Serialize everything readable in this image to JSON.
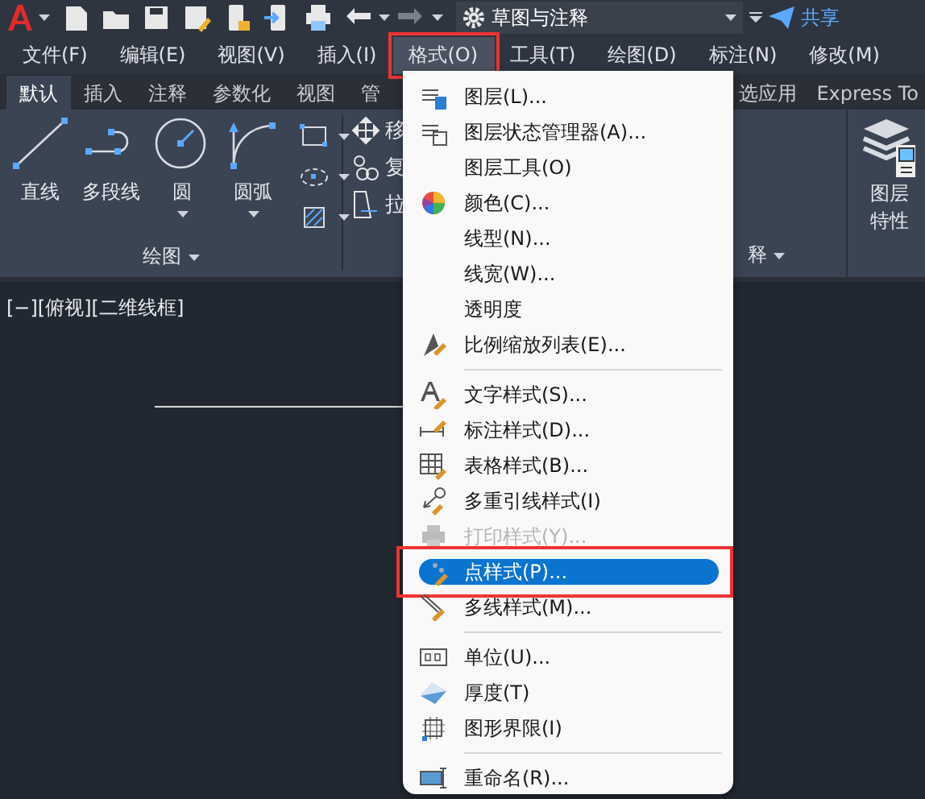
{
  "quick_access": {
    "workspace": "草图与注释",
    "share": "共享"
  },
  "menubar": [
    {
      "label": "文件(F)",
      "selected": false,
      "highlighted": false
    },
    {
      "label": "编辑(E)",
      "selected": false,
      "highlighted": false
    },
    {
      "label": "视图(V)",
      "selected": false,
      "highlighted": false
    },
    {
      "label": "插入(I)",
      "selected": false,
      "highlighted": false
    },
    {
      "label": "格式(O)",
      "selected": true,
      "highlighted": true
    },
    {
      "label": "工具(T)",
      "selected": false,
      "highlighted": false
    },
    {
      "label": "绘图(D)",
      "selected": false,
      "highlighted": false
    },
    {
      "label": "标注(N)",
      "selected": false,
      "highlighted": false
    },
    {
      "label": "修改(M)",
      "selected": false,
      "highlighted": false
    }
  ],
  "ribbon": {
    "tabs": [
      {
        "label": "默认",
        "selected": true
      },
      {
        "label": "插入",
        "selected": false
      },
      {
        "label": "注释",
        "selected": false
      },
      {
        "label": "参数化",
        "selected": false
      },
      {
        "label": "视图",
        "selected": false
      },
      {
        "label": "管",
        "selected": false
      }
    ],
    "tabs_right": [
      {
        "label": "选应用",
        "selected": false
      },
      {
        "label": "Express To",
        "selected": false
      }
    ],
    "draw_tools": [
      {
        "label": "直线",
        "dropdown": false
      },
      {
        "label": "多段线",
        "dropdown": false
      },
      {
        "label": "圆",
        "dropdown": true
      },
      {
        "label": "圆弧",
        "dropdown": true
      }
    ],
    "draw_panel": "绘图",
    "modify_tools": [
      "移",
      "复",
      "拉"
    ],
    "annotate_panel": "释",
    "layer_button": [
      "图层",
      "特性"
    ]
  },
  "viewport": {
    "label": "[−][俯视][二维线框]"
  },
  "menu": [
    {
      "kind": "item",
      "label": "图层(L)...",
      "disabled": false,
      "selected": false
    },
    {
      "kind": "item",
      "label": "图层状态管理器(A)...",
      "disabled": false,
      "selected": false
    },
    {
      "kind": "item",
      "label": "图层工具(O)",
      "disabled": false,
      "selected": false
    },
    {
      "kind": "item",
      "label": "颜色(C)...",
      "disabled": false,
      "selected": false
    },
    {
      "kind": "item",
      "label": "线型(N)...",
      "disabled": false,
      "selected": false
    },
    {
      "kind": "item",
      "label": "线宽(W)...",
      "disabled": false,
      "selected": false
    },
    {
      "kind": "item",
      "label": "透明度",
      "disabled": false,
      "selected": false
    },
    {
      "kind": "item",
      "label": "比例缩放列表(E)...",
      "disabled": false,
      "selected": false
    },
    {
      "kind": "separator"
    },
    {
      "kind": "item",
      "label": "文字样式(S)...",
      "disabled": false,
      "selected": false
    },
    {
      "kind": "item",
      "label": "标注样式(D)...",
      "disabled": false,
      "selected": false
    },
    {
      "kind": "item",
      "label": "表格样式(B)...",
      "disabled": false,
      "selected": false
    },
    {
      "kind": "item",
      "label": "多重引线样式(I)",
      "disabled": false,
      "selected": false
    },
    {
      "kind": "item",
      "label": "打印样式(Y)...",
      "disabled": true,
      "selected": false
    },
    {
      "kind": "item",
      "label": "点样式(P)...",
      "disabled": false,
      "selected": true,
      "highlighted": true
    },
    {
      "kind": "item",
      "label": "多线样式(M)...",
      "disabled": false,
      "selected": false
    },
    {
      "kind": "separator"
    },
    {
      "kind": "item",
      "label": "单位(U)...",
      "disabled": false,
      "selected": false
    },
    {
      "kind": "item",
      "label": "厚度(T)",
      "disabled": false,
      "selected": false
    },
    {
      "kind": "item",
      "label": "图形界限(I)",
      "disabled": false,
      "selected": false
    },
    {
      "kind": "separator"
    },
    {
      "kind": "item",
      "label": "重命名(R)...",
      "disabled": false,
      "selected": false
    }
  ]
}
